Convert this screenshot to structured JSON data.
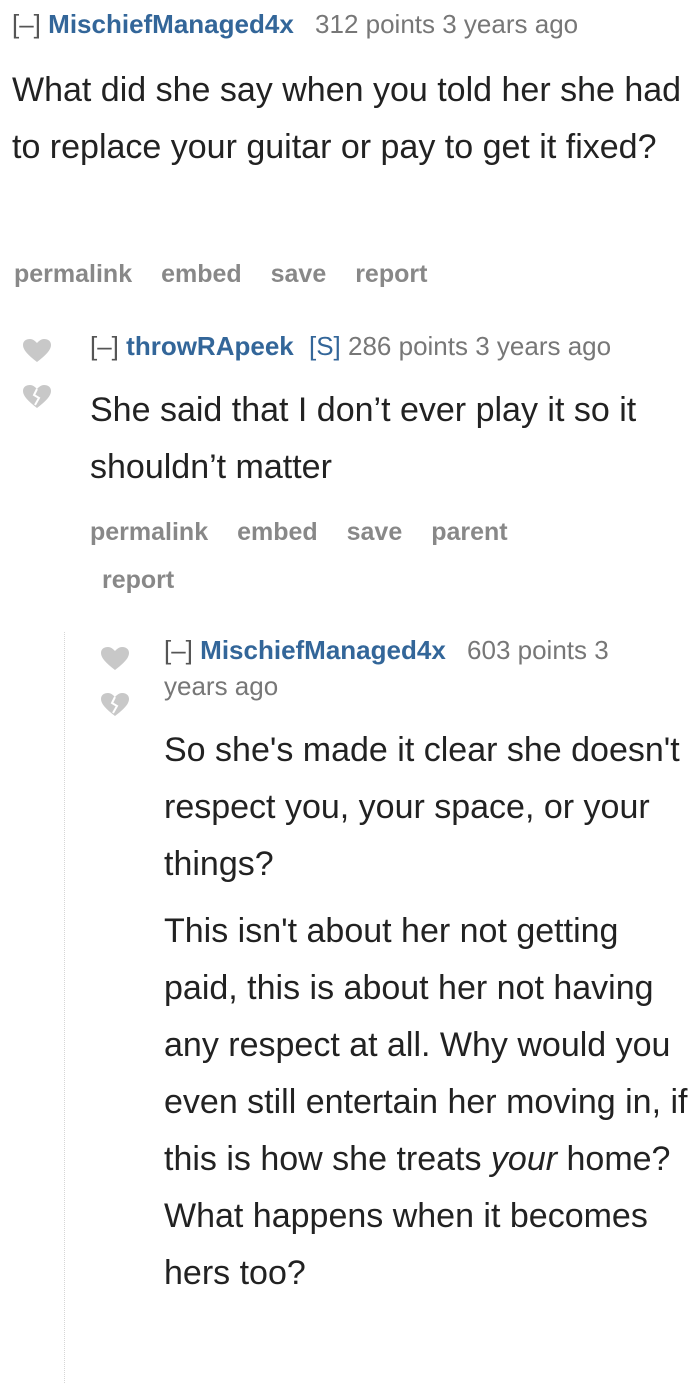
{
  "comments": [
    {
      "collapse": "[–]",
      "author": "MischiefManaged4x",
      "submitter_tag": "",
      "points": "312 points",
      "age": "3 years ago",
      "paragraphs": [
        "What did she say when you told her she had to replace your guitar or pay to get it fixed?"
      ],
      "actions": [
        "permalink",
        "embed",
        "save",
        "report"
      ]
    },
    {
      "collapse": "[–]",
      "author": "throwRApeek",
      "submitter_tag": "[S]",
      "points": "286 points",
      "age": "3 years ago",
      "paragraphs": [
        "She said that I don’t ever play it so it shouldn’t matter"
      ],
      "actions": [
        "permalink",
        "embed",
        "save",
        "parent",
        "report"
      ]
    },
    {
      "collapse": "[–]",
      "author": "MischiefManaged4x",
      "submitter_tag": "",
      "points": "603 points 3",
      "age": "years ago",
      "paragraphs": [
        "So she's made it clear she doesn't respect you, your space, or your things?",
        "This isn't about her not getting paid, this is about her not having any respect at all. Why would you even still entertain her moving in, if this is how she treats ",
        "your",
        " home? What happens when it becomes hers too?"
      ],
      "actions": []
    }
  ],
  "colors": {
    "author": "#336699",
    "meta": "#777777",
    "actions": "#888888",
    "vote": "#c8c8c8"
  }
}
